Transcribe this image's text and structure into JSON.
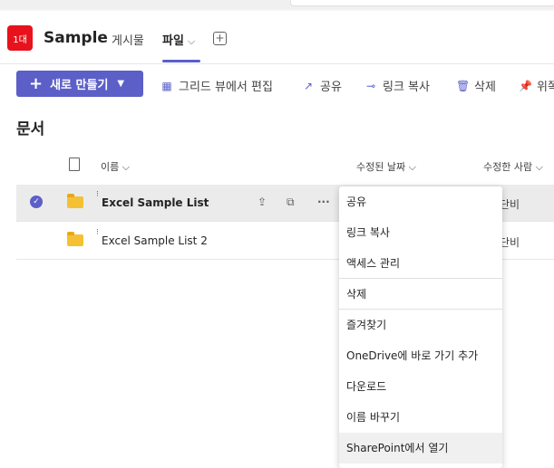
{
  "channel": {
    "icon_text": "1대",
    "name": "Sample"
  },
  "tabs": {
    "posts": "게시물",
    "files": "파일"
  },
  "toolbar": {
    "new_label": "새로 만들기",
    "grid_edit": "그리드 뷰에서 편집",
    "share": "공유",
    "copy_link": "링크 복사",
    "delete": "삭제",
    "pin": "위쪽"
  },
  "section_title": "문서",
  "columns": {
    "name": "이름",
    "modified": "수정된 날짜",
    "modified_by": "수정한 사람"
  },
  "rows": [
    {
      "name": "Excel Sample List",
      "modified_by": "단비"
    },
    {
      "name": "Excel Sample List 2",
      "modified_by": "단비"
    }
  ],
  "context_menu": {
    "items": [
      "공유",
      "링크 복사",
      "액세스 관리",
      "삭제",
      "즐겨찾기",
      "OneDrive에 바로 가기 추가",
      "다운로드",
      "이름 바꾸기",
      "SharePoint에서 열기"
    ]
  }
}
